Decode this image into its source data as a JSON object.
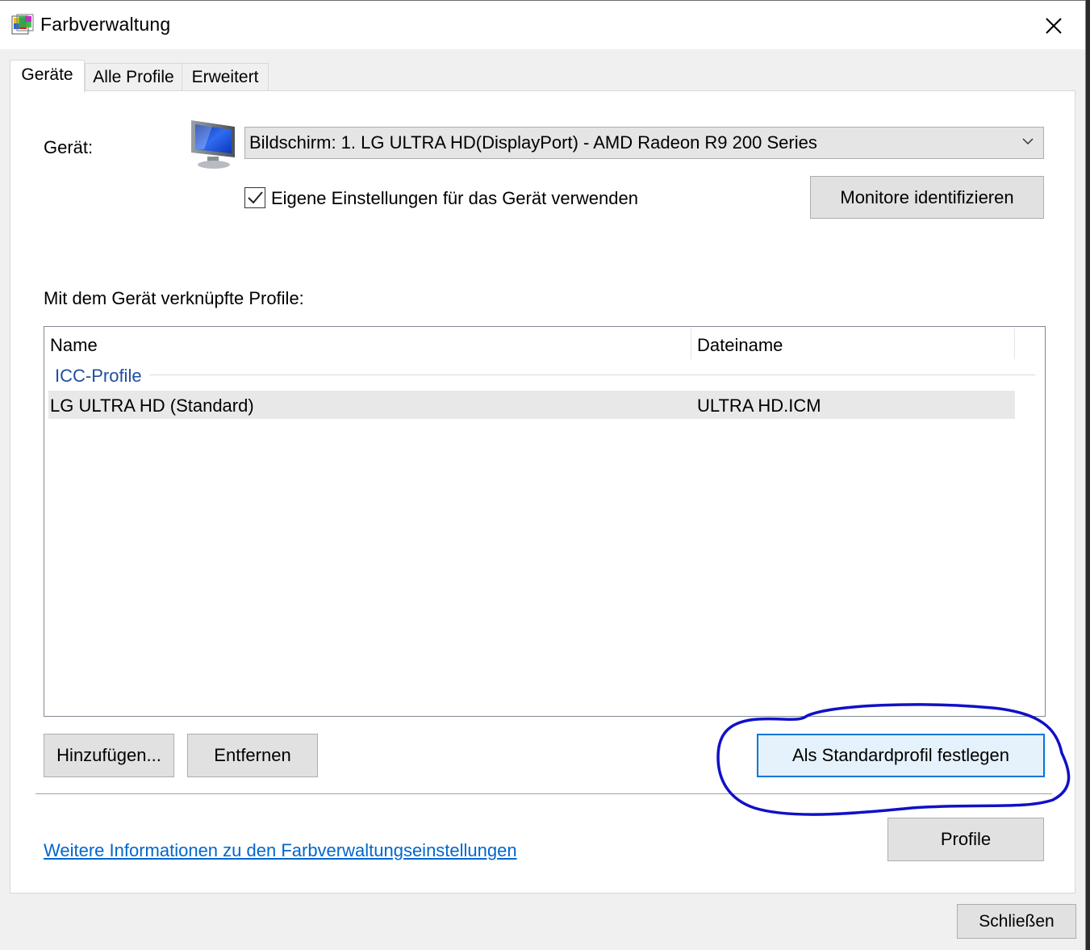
{
  "window": {
    "title": "Farbverwaltung",
    "close_label": "×"
  },
  "tabs": [
    {
      "label": "Geräte",
      "active": true
    },
    {
      "label": "Alle Profile",
      "active": false
    },
    {
      "label": "Erweitert",
      "active": false
    }
  ],
  "device": {
    "label": "Gerät:",
    "selected": "Bildschirm: 1. LG ULTRA HD(DisplayPort) - AMD Radeon R9 200 Series",
    "use_own_settings_label": "Eigene Einstellungen für das Gerät verwenden",
    "use_own_settings_checked": true,
    "identify_button": "Monitore identifizieren"
  },
  "profiles": {
    "section_label": "Mit dem Gerät verknüpfte Profile:",
    "columns": [
      "Name",
      "Dateiname"
    ],
    "group": "ICC-Profile",
    "rows": [
      {
        "name": "LG ULTRA HD (Standard)",
        "file": "ULTRA HD.ICM"
      }
    ]
  },
  "buttons": {
    "add": "Hinzufügen...",
    "remove": "Entfernen",
    "set_default": "Als Standardprofil festlegen",
    "profiles": "Profile",
    "close": "Schließen"
  },
  "link": "Weitere Informationen zu den Farbverwaltungseinstellungen",
  "colors": {
    "accent": "#0078d7",
    "link": "#0066cc",
    "group_header": "#1e50a0",
    "annotation": "#1010c8"
  }
}
